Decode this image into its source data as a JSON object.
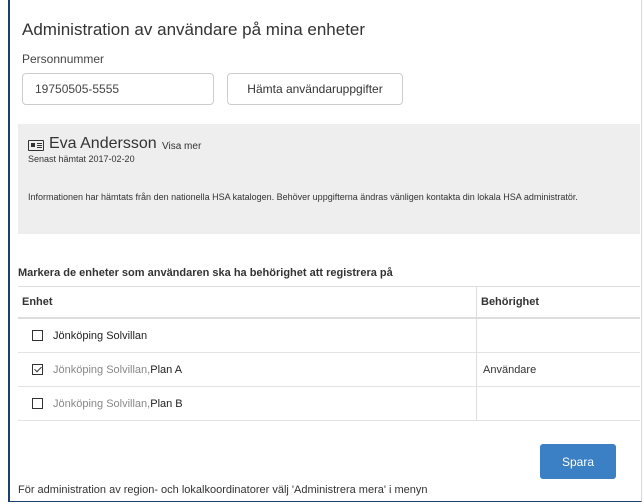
{
  "page": {
    "title": "Administration av användare på mina enheter"
  },
  "search": {
    "label": "Personnummer",
    "value": "19750505-5555",
    "button_label": "Hämta användaruppgifter"
  },
  "user": {
    "icon": "id-card-icon",
    "name": "Eva Andersson",
    "show_more": "Visa mer",
    "fetched": "Senast hämtat 2017-02-20",
    "info": "Informationen har hämtats från den nationella HSA katalogen. Behöver uppgifterna ändras vänligen kontakta din lokala HSA administratör."
  },
  "units": {
    "heading": "Markera de enheter som användaren ska ha behörighet att registrera på",
    "columns": [
      "Enhet",
      "Behörighet"
    ],
    "rows": [
      {
        "checked": false,
        "unit": "Jönköping Solvillan",
        "plan": "",
        "role": ""
      },
      {
        "checked": true,
        "unit": "Jönköping Solvillan, ",
        "plan": "Plan A",
        "role": "Användare"
      },
      {
        "checked": false,
        "unit": "Jönköping Solvillan, ",
        "plan": "Plan B",
        "role": ""
      }
    ]
  },
  "actions": {
    "save_label": "Spara"
  },
  "footer": {
    "note": "För administration av region- och lokalkoordinatorer välj 'Administrera mera' i menyn"
  },
  "colors": {
    "accent": "#3b7fc4",
    "frame": "#1a3f73",
    "panel": "#eeeeee"
  }
}
